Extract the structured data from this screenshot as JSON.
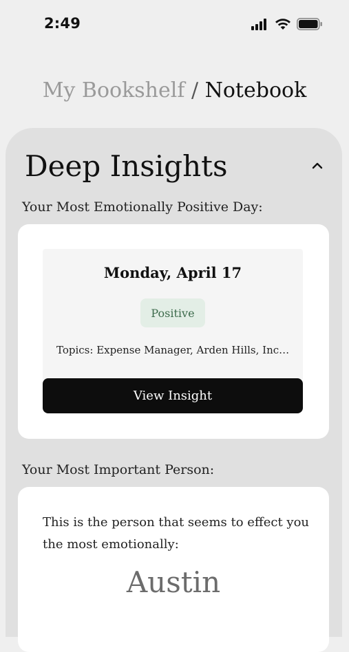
{
  "status_bar": {
    "time": "2:49"
  },
  "breadcrumb": {
    "parent": "My Bookshelf",
    "separator": " / ",
    "current": "Notebook"
  },
  "panel": {
    "title": "Deep Insights",
    "collapse_icon": "chevron-up-icon"
  },
  "positive_day": {
    "section_label": "Your Most Emotionally Positive Day:",
    "date": "Monday, April 17",
    "sentiment": "Positive",
    "topics": "Topics: Expense Manager, Arden Hills, Inco...",
    "button_label": "View Insight"
  },
  "important_person": {
    "section_label": "Your Most Important Person:",
    "description": "This is the person that seems to effect you the most emotionally:",
    "name": "Austin"
  },
  "colors": {
    "background": "#efefef",
    "panel": "#e0e0e0",
    "badge_bg": "#e3eee6",
    "badge_text": "#3d6b4c",
    "button_bg": "#0d0d0d"
  }
}
